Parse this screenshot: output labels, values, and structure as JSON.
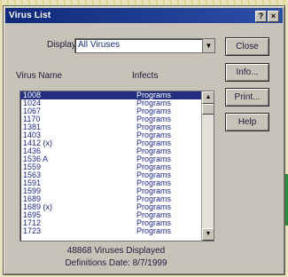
{
  "window": {
    "title": "Virus List"
  },
  "display": {
    "label": "Display:",
    "selected": "All Viruses"
  },
  "columns": {
    "name": "Virus Name",
    "infects": "Infects"
  },
  "buttons": {
    "close": "Close",
    "info": "Info...",
    "print": "Print...",
    "help": "Help"
  },
  "list": {
    "rows": [
      {
        "name": "1008",
        "infects": "Programs"
      },
      {
        "name": "1024",
        "infects": "Programs"
      },
      {
        "name": "1067",
        "infects": "Programs"
      },
      {
        "name": "1170",
        "infects": "Programs"
      },
      {
        "name": "1381",
        "infects": "Programs"
      },
      {
        "name": "1403",
        "infects": "Programs"
      },
      {
        "name": "1412 (x)",
        "infects": "Programs"
      },
      {
        "name": "1436",
        "infects": "Programs"
      },
      {
        "name": "1536 A",
        "infects": "Programs"
      },
      {
        "name": "1559",
        "infects": "Programs"
      },
      {
        "name": "1563",
        "infects": "Programs"
      },
      {
        "name": "1591",
        "infects": "Programs"
      },
      {
        "name": "1599",
        "infects": "Programs"
      },
      {
        "name": "1689",
        "infects": "Programs"
      },
      {
        "name": "1689 (x)",
        "infects": "Programs"
      },
      {
        "name": "1695",
        "infects": "Programs"
      },
      {
        "name": "1712",
        "infects": "Programs"
      },
      {
        "name": "1723",
        "infects": "Programs"
      }
    ]
  },
  "status": {
    "count": "48868 Viruses Displayed",
    "date": "Definitions Date: 8/7/1999"
  }
}
